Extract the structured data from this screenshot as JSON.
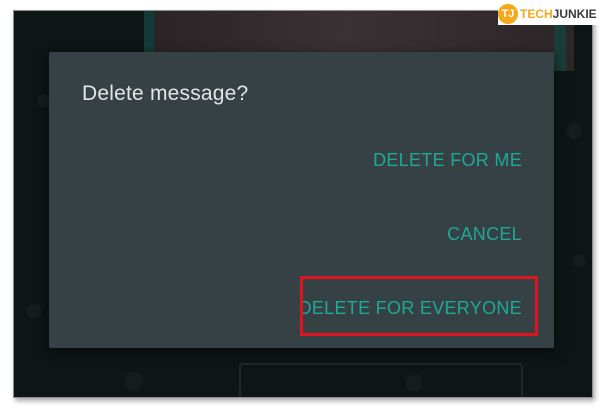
{
  "dialog": {
    "title": "Delete message?",
    "actions": {
      "delete_for_me": "DELETE FOR ME",
      "cancel": "CANCEL",
      "delete_for_everyone": "DELETE FOR EVERYONE"
    }
  },
  "watermark": {
    "badge": "TJ",
    "brand_part1": "TECH",
    "brand_part2": "JUNKIE"
  },
  "colors": {
    "dialog_background": "#364146",
    "action_text": "#1ea995",
    "highlight_border": "#e0141e",
    "backdrop": "#0d1615"
  }
}
